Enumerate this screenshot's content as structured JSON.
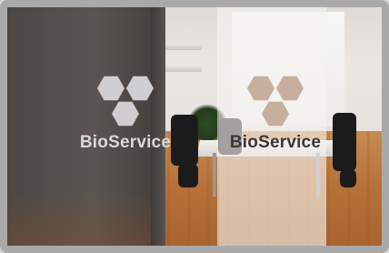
{
  "image": {
    "description_text": "",
    "brand_left": "BioService",
    "brand_right": "BioService"
  },
  "colors": {
    "frame": "#a9a9a9",
    "dark_panel": "#4b4745",
    "frosted_glass": "#f5f4f0",
    "floor_wood": "#b8733a",
    "logo_light": "#d9d9db",
    "logo_dark": "#3b3735"
  }
}
